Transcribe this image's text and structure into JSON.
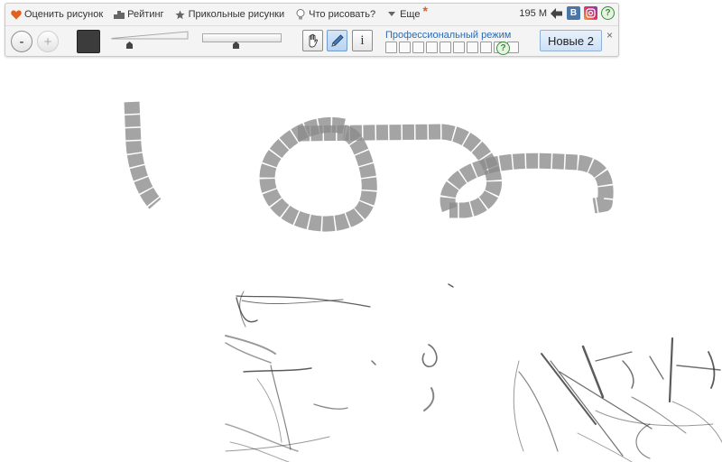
{
  "menu": {
    "rate": "Оценить рисунок",
    "rating": "Рейтинг",
    "funny": "Прикольные рисунки",
    "what_draw": "Что рисовать?",
    "more": "Еще",
    "more_star": "*"
  },
  "counter": "195 М",
  "social": {
    "vk": "B"
  },
  "help_mark": "?",
  "brush": {
    "minus": "-",
    "plus": "+",
    "color": "#3c3c3c"
  },
  "info_label": "i",
  "pro_mode": {
    "label": "Профессиональный режим",
    "slot_count": 10
  },
  "new_button": "Новые 2",
  "close_label": "×",
  "colors": {
    "accent_link": "#2a6bb5",
    "heart": "#e2601f",
    "vk": "#4a76a8"
  }
}
